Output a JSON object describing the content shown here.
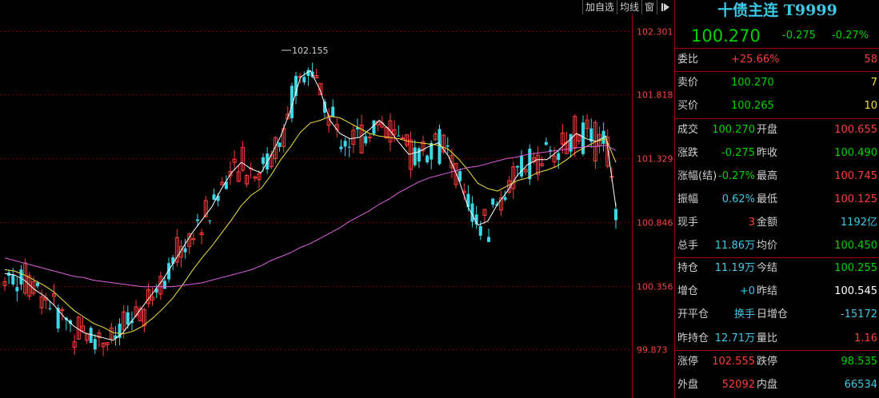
{
  "toolbar": {
    "add_watch": "加自选",
    "ma_line": "均线",
    "window": "窗"
  },
  "quote": {
    "title": "十债主连 T9999",
    "last": "100.270",
    "change": "-0.275",
    "change_pct": "-0.27%",
    "wei_bi_label": "委比",
    "wei_bi": "+25.66%",
    "wei_cha": "58",
    "sell_label": "卖价",
    "sell_price": "100.270",
    "sell_vol": "7",
    "buy_label": "买价",
    "buy_price": "100.265",
    "buy_vol": "10",
    "rows": [
      {
        "l1": "成交",
        "v1": "100.270",
        "c1": "green",
        "l2": "开盘",
        "v2": "100.655",
        "c2": "red"
      },
      {
        "l1": "涨跌",
        "v1": "-0.275",
        "c1": "green",
        "l2": "昨收",
        "v2": "100.490",
        "c2": "green"
      },
      {
        "l1": "涨幅(结)",
        "v1": "-0.27%",
        "c1": "green",
        "l2": "最高",
        "v2": "100.745",
        "c2": "red"
      },
      {
        "l1": "振幅",
        "v1": "0.62%",
        "c1": "cyan",
        "l2": "最低",
        "v2": "100.125",
        "c2": "red"
      },
      {
        "l1": "现手",
        "v1": "3",
        "c1": "red",
        "l2": "金额",
        "v2": "1192亿",
        "c2": "cyan"
      },
      {
        "l1": "总手",
        "v1": "11.86万",
        "c1": "cyan",
        "l2": "均价",
        "v2": "100.450",
        "c2": "green"
      },
      {
        "l1": "持仓",
        "v1": "11.19万",
        "c1": "cyan",
        "l2": "今结",
        "v2": "100.255",
        "c2": "green"
      },
      {
        "l1": "增仓",
        "v1": "+0",
        "c1": "cyan",
        "l2": "昨结",
        "v2": "100.545",
        "c2": "white"
      },
      {
        "l1": "开平仓",
        "v1": "换手",
        "c1": "cyan",
        "l2": "日增仓",
        "v2": "-15172",
        "c2": "cyan"
      },
      {
        "l1": "昨持仓",
        "v1": "12.71万",
        "c1": "cyan",
        "l2": "量比",
        "v2": "1.16",
        "c2": "red"
      },
      {
        "l1": "涨停",
        "v1": "102.555",
        "c1": "red",
        "l2": "跌停",
        "v2": "98.535",
        "c2": "green"
      },
      {
        "l1": "外盘",
        "v1": "52092",
        "c1": "red",
        "l2": "内盘",
        "v2": "66534",
        "c2": "cyan"
      }
    ]
  },
  "colors": {
    "up": "#ff3c3c",
    "down": "#3cd8e8",
    "ma5": "#ffffff",
    "ma10": "#f0e040",
    "ma60": "#e060e0",
    "grid": "#7a0000"
  },
  "chart_data": {
    "type": "candlestick",
    "y_ticks": [
      "102.301",
      "101.818",
      "101.329",
      "100.846",
      "100.356",
      "99.873"
    ],
    "y_range": [
      99.873,
      102.301
    ],
    "high_annotation": "102.155",
    "series": [
      {
        "name": "MA5",
        "values": [
          100.45,
          100.44,
          100.4,
          100.33,
          100.28,
          100.21,
          100.12,
          100.05,
          100.0,
          99.98,
          99.96,
          99.94,
          100.0,
          100.1,
          100.2,
          100.3,
          100.4,
          100.52,
          100.64,
          100.76,
          100.86,
          100.96,
          101.1,
          101.22,
          101.3,
          101.25,
          101.22,
          101.35,
          101.5,
          101.7,
          101.95,
          102.0,
          101.85,
          101.62,
          101.52,
          101.48,
          101.49,
          101.55,
          101.62,
          101.55,
          101.45,
          101.36,
          101.38,
          101.42,
          101.45,
          101.35,
          101.18,
          100.96,
          100.82,
          100.85,
          100.98,
          101.08,
          101.2,
          101.28,
          101.32,
          101.32,
          101.38,
          101.45,
          101.52,
          101.48,
          101.46,
          101.5,
          100.96
        ]
      },
      {
        "name": "MA10",
        "values": [
          100.48,
          100.47,
          100.44,
          100.4,
          100.36,
          100.31,
          100.24,
          100.17,
          100.12,
          100.07,
          100.04,
          100.0,
          99.99,
          100.01,
          100.05,
          100.11,
          100.18,
          100.26,
          100.36,
          100.47,
          100.57,
          100.66,
          100.76,
          100.86,
          100.97,
          101.05,
          101.1,
          101.2,
          101.32,
          101.42,
          101.53,
          101.6,
          101.62,
          101.65,
          101.64,
          101.6,
          101.56,
          101.52,
          101.5,
          101.49,
          101.48,
          101.46,
          101.45,
          101.44,
          101.43,
          101.4,
          101.33,
          101.24,
          101.14,
          101.1,
          101.08,
          101.12,
          101.16,
          101.18,
          101.22,
          101.24,
          101.27,
          101.32,
          101.38,
          101.42,
          101.46,
          101.48,
          101.3
        ]
      },
      {
        "name": "MA60",
        "values": [
          100.57,
          100.55,
          100.53,
          100.51,
          100.49,
          100.47,
          100.45,
          100.43,
          100.42,
          100.4,
          100.39,
          100.38,
          100.37,
          100.36,
          100.35,
          100.35,
          100.35,
          100.35,
          100.36,
          100.37,
          100.38,
          100.4,
          100.42,
          100.44,
          100.46,
          100.48,
          100.51,
          100.55,
          100.58,
          100.61,
          100.65,
          100.68,
          100.72,
          100.76,
          100.8,
          100.85,
          100.89,
          100.93,
          100.98,
          101.02,
          101.07,
          101.11,
          101.15,
          101.18,
          101.2,
          101.22,
          101.24,
          101.26,
          101.27,
          101.29,
          101.31,
          101.33,
          101.34,
          101.36,
          101.37,
          101.38,
          101.39,
          101.4,
          101.41,
          101.42,
          101.42,
          101.43,
          101.39
        ]
      }
    ]
  }
}
